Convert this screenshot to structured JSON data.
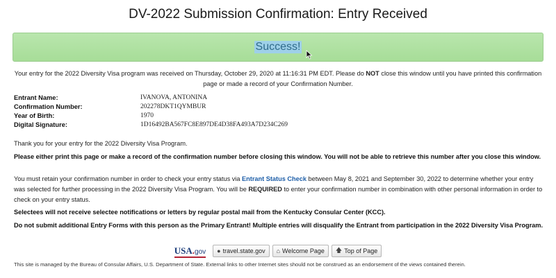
{
  "page_title": "DV-2022 Submission Confirmation: Entry Received",
  "success_label": "Success!",
  "intro": {
    "part1": "Your entry for the 2022 Diversity Visa program was received on Thursday, October 29, 2020 at 11:16:31 PM EDT. Please do ",
    "not": "NOT",
    "part2": " close this window until you have printed this confirmation page or made a record of your Confirmation Number."
  },
  "entrant": {
    "name_label": "Entrant Name:",
    "name_value": "IVANOVA, ANTONINA",
    "confirmation_label": "Confirmation Number:",
    "confirmation_value": "202278DKT1QYMBUR",
    "birth_label": "Year of Birth:",
    "birth_value": "1970",
    "signature_label": "Digital Signature:",
    "signature_value": "1D16492BA567FC8E897DE4D38FA493A7D234C269"
  },
  "thanks": "Thank you for your entry for the 2022 Diversity Visa Program.",
  "print_notice": "Please either print this page or make a record of the confirmation number before closing this window. You will not be able to retrieve this number after you close this window.",
  "retain": {
    "part1": "You must retain your confirmation number in order to check your entry status via ",
    "link": "Entrant Status Check",
    "part2": " between May 8, 2021 and September 30, 2022 to determine whether your entry was selected for further processing in the 2022 Diversity Visa Program. You will be ",
    "required": "REQUIRED",
    "part3": " to enter your confirmation number in combination with other personal information in order to check on your entry status."
  },
  "selectees_notice": "Selectees will not receive selectee notifications or letters by regular postal mail from the Kentucky Consular Center (KCC).",
  "multiple_notice": "Do not submit additional Entry Forms with this person as the Primary Entrant! Multiple entries will disqualify the Entrant from participation in the 2022 Diversity Visa Program.",
  "footer": {
    "logo_usa": "USA",
    "logo_dot": ".",
    "logo_gov": "gov",
    "buttons": [
      {
        "label": "travel.state.gov",
        "icon": "globe-icon"
      },
      {
        "label": "Welcome Page",
        "icon": "home-icon"
      },
      {
        "label": "Top of Page",
        "icon": "up-arrow-icon"
      }
    ],
    "disclaimer": "This site is managed by the Bureau of Consular Affairs, U.S. Department of State. External links to other Internet sites should not be construed as an endorsement of the views contained therein."
  },
  "colors": {
    "success_bg": "#a7dd98",
    "link": "#1d5ea8",
    "highlight": "#9ed0e8"
  }
}
